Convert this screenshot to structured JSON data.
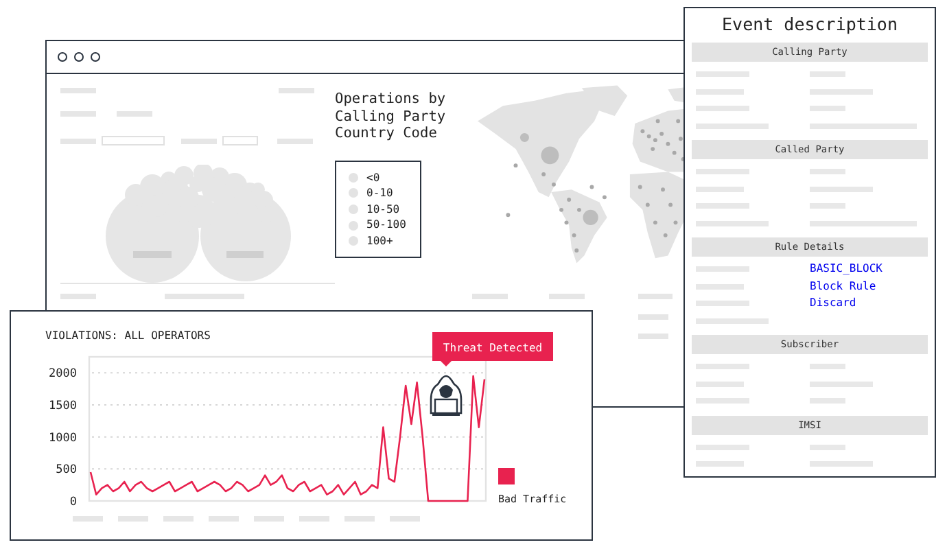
{
  "main_window": {
    "map_title": "Operations by Calling Party Country Code",
    "legend": [
      "<0",
      "0-10",
      "10-50",
      "50-100",
      "100+"
    ]
  },
  "event_panel": {
    "title": "Event description",
    "sections": [
      {
        "title": "Calling Party",
        "rows": [
          {
            "kind": "placeholder"
          },
          {
            "kind": "placeholder"
          },
          {
            "kind": "placeholder"
          },
          {
            "kind": "placeholder"
          }
        ]
      },
      {
        "title": "Called Party",
        "rows": [
          {
            "kind": "placeholder"
          },
          {
            "kind": "placeholder"
          },
          {
            "kind": "placeholder"
          },
          {
            "kind": "placeholder"
          }
        ]
      },
      {
        "title": "Rule Details",
        "rows": [
          {
            "kind": "value",
            "value": "BASIC_BLOCK"
          },
          {
            "kind": "value",
            "value": "Block Rule"
          },
          {
            "kind": "value",
            "value": "Discard"
          },
          {
            "kind": "label_only"
          }
        ]
      },
      {
        "title": "Subscriber",
        "rows": [
          {
            "kind": "placeholder"
          },
          {
            "kind": "placeholder"
          },
          {
            "kind": "placeholder"
          }
        ]
      },
      {
        "title": "IMSI",
        "rows": [
          {
            "kind": "placeholder"
          },
          {
            "kind": "placeholder"
          }
        ]
      }
    ]
  },
  "violations_chart": {
    "tooltip": "Threat Detected",
    "chart_data": {
      "type": "line",
      "grid": true,
      "title": "VIOLATIONS: ALL OPERATORS",
      "ylim": [
        0,
        2250
      ],
      "yticks": [
        0,
        500,
        1000,
        1500,
        2000
      ],
      "series": [
        {
          "name": "Bad Traffic",
          "color": "#e8224f",
          "values": [
            450,
            100,
            200,
            250,
            150,
            200,
            300,
            150,
            250,
            300,
            200,
            150,
            200,
            250,
            300,
            150,
            200,
            250,
            300,
            150,
            200,
            250,
            300,
            250,
            150,
            200,
            300,
            250,
            150,
            200,
            250,
            400,
            250,
            300,
            400,
            200,
            150,
            250,
            300,
            150,
            200,
            250,
            100,
            150,
            250,
            100,
            200,
            300,
            100,
            150,
            250,
            200,
            1150,
            350,
            300,
            1000,
            1800,
            1200,
            1850,
            1000,
            0,
            0,
            0,
            0,
            0,
            0,
            0,
            0,
            1950,
            1150,
            1900
          ]
        }
      ]
    }
  }
}
